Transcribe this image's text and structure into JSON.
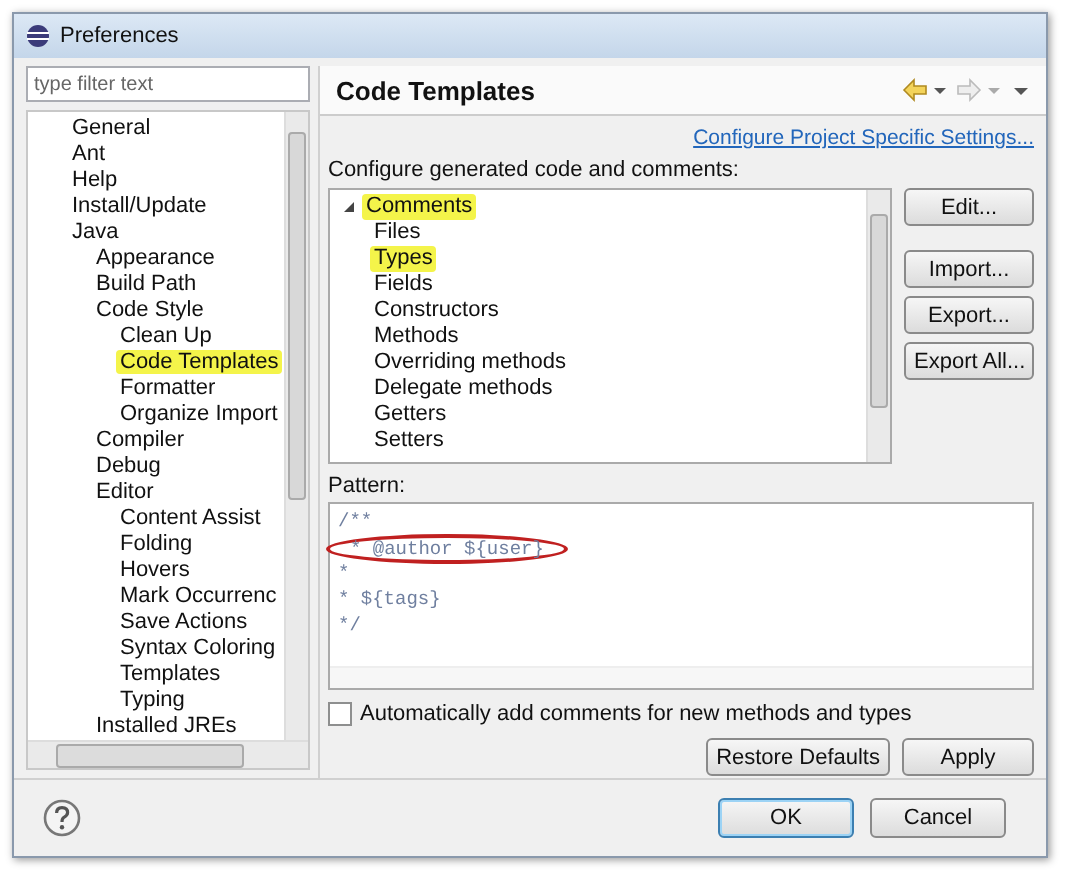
{
  "window": {
    "title": "Preferences"
  },
  "filter": {
    "placeholder": "type filter text"
  },
  "preferences_tree": [
    {
      "label": "General",
      "selected": false
    },
    {
      "label": "Ant",
      "selected": false
    },
    {
      "label": "Help",
      "selected": false
    },
    {
      "label": "Install/Update",
      "selected": false
    },
    {
      "label": "Java",
      "selected": false,
      "children": [
        {
          "label": "Appearance",
          "selected": false
        },
        {
          "label": "Build Path",
          "selected": false
        },
        {
          "label": "Code Style",
          "selected": false,
          "children": [
            {
              "label": "Clean Up",
              "selected": false
            },
            {
              "label": "Code Templates",
              "selected": true
            },
            {
              "label": "Formatter",
              "selected": false
            },
            {
              "label": "Organize Import",
              "selected": false
            }
          ]
        },
        {
          "label": "Compiler",
          "selected": false
        },
        {
          "label": "Debug",
          "selected": false
        },
        {
          "label": "Editor",
          "selected": false,
          "children": [
            {
              "label": "Content Assist",
              "selected": false
            },
            {
              "label": "Folding",
              "selected": false
            },
            {
              "label": "Hovers",
              "selected": false
            },
            {
              "label": "Mark Occurrenc",
              "selected": false
            },
            {
              "label": "Save Actions",
              "selected": false
            },
            {
              "label": "Syntax Coloring",
              "selected": false
            },
            {
              "label": "Templates",
              "selected": false
            },
            {
              "label": "Typing",
              "selected": false
            }
          ]
        },
        {
          "label": "Installed JREs",
          "selected": false
        }
      ]
    }
  ],
  "page": {
    "title": "Code Templates",
    "link": "Configure Project Specific Settings...",
    "tree_label": "Configure generated code and comments:"
  },
  "templates_tree": [
    {
      "label": "Comments",
      "selected": true,
      "expanded": true,
      "children": [
        {
          "label": "Files",
          "selected": false
        },
        {
          "label": "Types",
          "selected": true
        },
        {
          "label": "Fields",
          "selected": false
        },
        {
          "label": "Constructors",
          "selected": false
        },
        {
          "label": "Methods",
          "selected": false
        },
        {
          "label": "Overriding methods",
          "selected": false
        },
        {
          "label": "Delegate methods",
          "selected": false
        },
        {
          "label": "Getters",
          "selected": false
        },
        {
          "label": "Setters",
          "selected": false
        }
      ]
    }
  ],
  "side_buttons": [
    "Edit...",
    "Import...",
    "Export...",
    "Export All..."
  ],
  "pattern": {
    "label": "Pattern:",
    "lines": [
      {
        "text": "/**",
        "circled": false
      },
      {
        "text": "* @author ${user}",
        "circled": true
      },
      {
        "text": "*",
        "circled": false
      },
      {
        "text": "* ${tags}",
        "circled": false
      },
      {
        "text": "*/",
        "circled": false
      }
    ]
  },
  "auto_comments": {
    "label": "Automatically add comments for new methods and types",
    "checked": false
  },
  "page_buttons": [
    "Restore Defaults",
    "Apply"
  ],
  "dialog_buttons": [
    "OK",
    "Cancel"
  ]
}
